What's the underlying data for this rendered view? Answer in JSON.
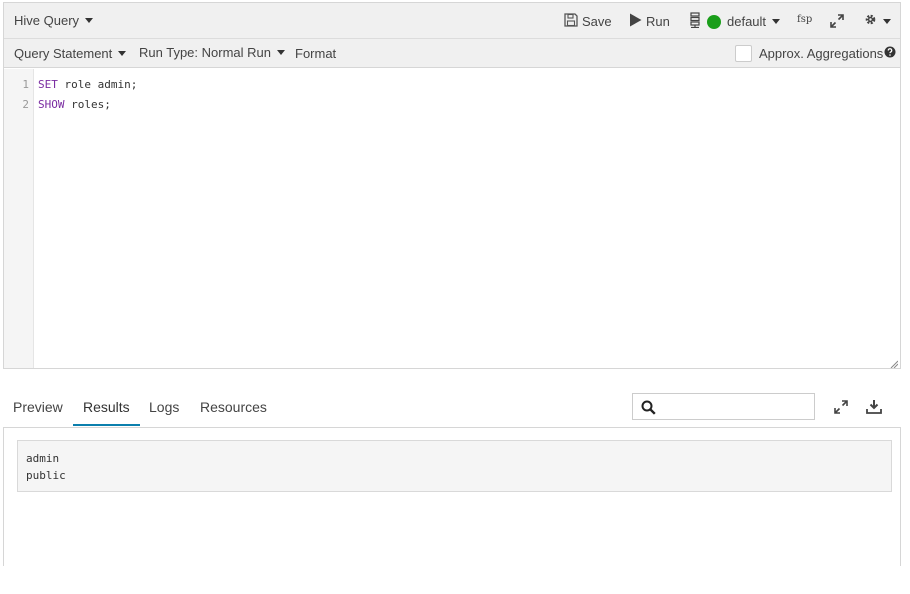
{
  "toolbar": {
    "title": "Hive Query",
    "save_label": "Save",
    "run_label": "Run",
    "database": "default",
    "format_short": "fsp"
  },
  "subtoolbar": {
    "query_statement": "Query Statement",
    "run_type": "Run Type: Normal Run",
    "format": "Format",
    "approx_agg": "Approx. Aggregations"
  },
  "editor": {
    "lines": [
      {
        "num": "1",
        "keyword": "SET",
        "rest": " role admin;"
      },
      {
        "num": "2",
        "keyword": "SHOW",
        "rest": " roles;"
      }
    ]
  },
  "tabs": [
    {
      "label": "Preview",
      "active": false
    },
    {
      "label": "Results",
      "active": true
    },
    {
      "label": "Logs",
      "active": false
    },
    {
      "label": "Resources",
      "active": false
    }
  ],
  "search": {
    "placeholder": ""
  },
  "results": [
    "admin",
    "public"
  ],
  "colors": {
    "accent": "#0b7fad",
    "status_green": "#1a9e1a",
    "keyword": "#7a2ca1"
  }
}
